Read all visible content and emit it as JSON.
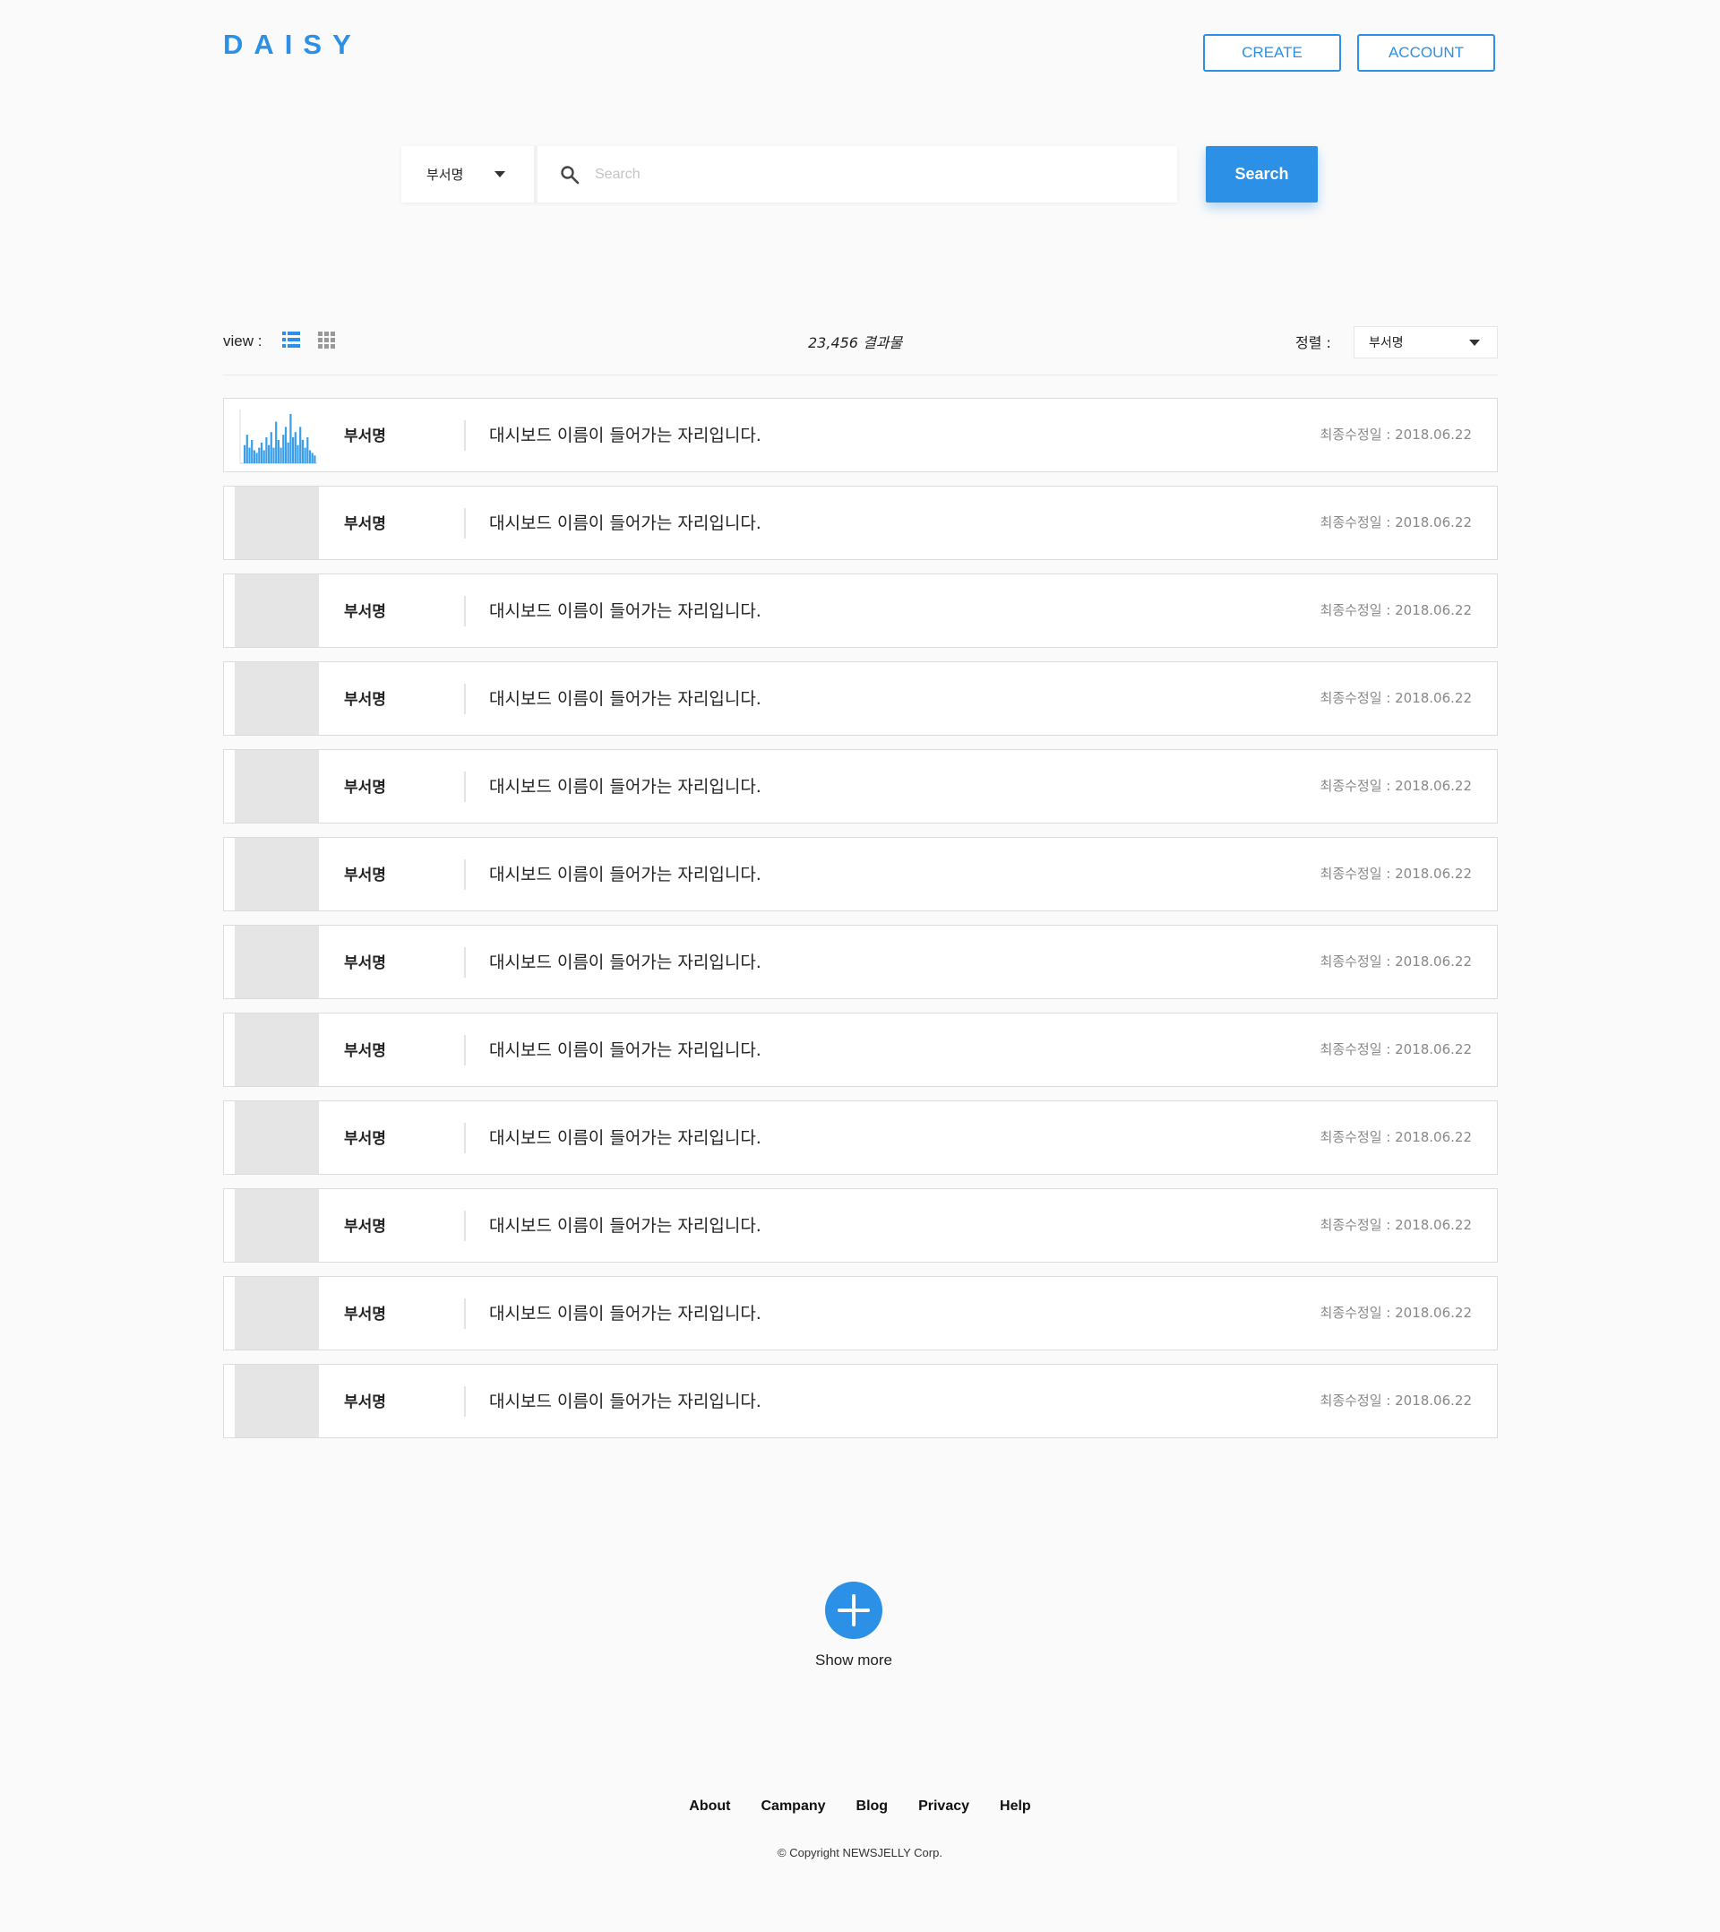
{
  "header": {
    "logo": "DAISY",
    "create_label": "CREATE",
    "account_label": "ACCOUNT"
  },
  "search": {
    "category": "부서명",
    "placeholder": "Search",
    "button_label": "Search"
  },
  "toolbar": {
    "view_label": "view :",
    "result_count": "23,456 결과물",
    "sort_label": "정렬 :",
    "sort_value": "부서명",
    "active_view": "list"
  },
  "rows": [
    {
      "dept": "부서명",
      "title": "대시보드 이름이 들어가는 자리입니다.",
      "date": "최종수정일 : 2018.06.22",
      "thumb": "bar-chart"
    },
    {
      "dept": "부서명",
      "title": "대시보드 이름이 들어가는 자리입니다.",
      "date": "최종수정일 : 2018.06.22",
      "thumb": "placeholder"
    },
    {
      "dept": "부서명",
      "title": "대시보드 이름이 들어가는 자리입니다.",
      "date": "최종수정일 : 2018.06.22",
      "thumb": "placeholder"
    },
    {
      "dept": "부서명",
      "title": "대시보드 이름이 들어가는 자리입니다.",
      "date": "최종수정일 : 2018.06.22",
      "thumb": "placeholder"
    },
    {
      "dept": "부서명",
      "title": "대시보드 이름이 들어가는 자리입니다.",
      "date": "최종수정일 : 2018.06.22",
      "thumb": "placeholder"
    },
    {
      "dept": "부서명",
      "title": "대시보드 이름이 들어가는 자리입니다.",
      "date": "최종수정일 : 2018.06.22",
      "thumb": "placeholder"
    },
    {
      "dept": "부서명",
      "title": "대시보드 이름이 들어가는 자리입니다.",
      "date": "최종수정일 : 2018.06.22",
      "thumb": "placeholder"
    },
    {
      "dept": "부서명",
      "title": "대시보드 이름이 들어가는 자리입니다.",
      "date": "최종수정일 : 2018.06.22",
      "thumb": "placeholder"
    },
    {
      "dept": "부서명",
      "title": "대시보드 이름이 들어가는 자리입니다.",
      "date": "최종수정일 : 2018.06.22",
      "thumb": "placeholder"
    },
    {
      "dept": "부서명",
      "title": "대시보드 이름이 들어가는 자리입니다.",
      "date": "최종수정일 : 2018.06.22",
      "thumb": "placeholder"
    },
    {
      "dept": "부서명",
      "title": "대시보드 이름이 들어가는 자리입니다.",
      "date": "최종수정일 : 2018.06.22",
      "thumb": "placeholder"
    },
    {
      "dept": "부서명",
      "title": "대시보드 이름이 들어가는 자리입니다.",
      "date": "최종수정일 : 2018.06.22",
      "thumb": "placeholder"
    }
  ],
  "show_more": {
    "label": "Show more",
    "icon": "plus-icon"
  },
  "footer": {
    "links": [
      "About",
      "Campany",
      "Blog",
      "Privacy",
      "Help"
    ],
    "copyright": "© Copyright NEWSJELLY Corp."
  },
  "colors": {
    "accent": "#2b90e6",
    "thumb_placeholder": "#e5e5e5",
    "background": "#fafafa"
  }
}
